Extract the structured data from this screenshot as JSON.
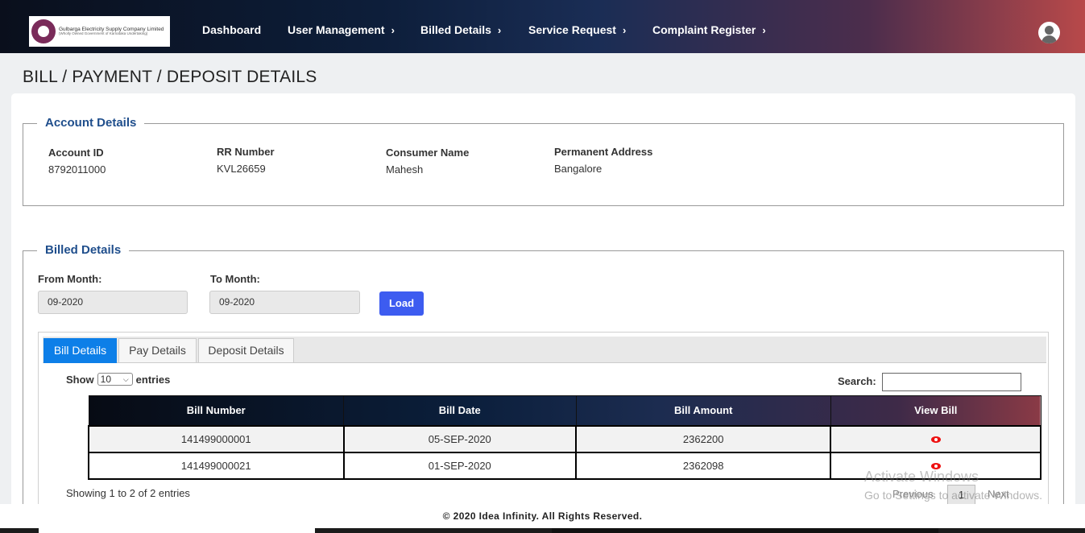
{
  "header": {
    "logo": {
      "line1": "Gulbarga Electricity Supply Company Limited",
      "line2": "(Wholly Owned Government of Karnataka Undertaking)"
    },
    "nav": [
      {
        "label": "Dashboard",
        "has_submenu": false
      },
      {
        "label": "User Management",
        "has_submenu": true
      },
      {
        "label": "Billed Details",
        "has_submenu": true
      },
      {
        "label": "Service Request",
        "has_submenu": true
      },
      {
        "label": "Complaint Register",
        "has_submenu": true
      }
    ],
    "chevron": "›"
  },
  "page": {
    "title": "BILL / PAYMENT / DEPOSIT DETAILS"
  },
  "account": {
    "legend": "Account Details",
    "fields": [
      {
        "label": "Account ID",
        "value": "8792011000"
      },
      {
        "label": "RR Number",
        "value": "KVL26659"
      },
      {
        "label": "Consumer Name",
        "value": "Mahesh"
      },
      {
        "label": "Permanent Address",
        "value": "Bangalore"
      }
    ]
  },
  "billed": {
    "legend": "Billed Details",
    "from_label": "From Month:",
    "from_value": "09-2020",
    "to_label": "To Month:",
    "to_value": "09-2020",
    "load_label": "Load",
    "tabs": [
      {
        "label": "Bill Details",
        "active": true
      },
      {
        "label": "Pay Details",
        "active": false
      },
      {
        "label": "Deposit Details",
        "active": false
      }
    ],
    "show_label": "Show",
    "entries_value": "10",
    "entries_label": "entries",
    "search_label": "Search:",
    "table": {
      "headers": [
        "Bill Number",
        "Bill Date",
        "Bill Amount",
        "View Bill"
      ],
      "rows": [
        {
          "bill_number": "141499000001",
          "bill_date": "05-SEP-2020",
          "bill_amount": "2362200"
        },
        {
          "bill_number": "141499000021",
          "bill_date": "01-SEP-2020",
          "bill_amount": "2362098"
        }
      ]
    },
    "showing_text": "Showing 1 to 2 of 2 entries",
    "pager": {
      "previous": "Previous",
      "page": "1",
      "next": "Next"
    }
  },
  "watermark": {
    "line1": "Activate Windows",
    "line2": "Go to Settings to activate Windows."
  },
  "footer": {
    "text": "© 2020 Idea Infinity. All Rights Reserved."
  },
  "colors": {
    "accent_blue": "#0d7fe8",
    "load_button": "#3d5cf0",
    "legend_text": "#1f4e8c",
    "view_icon": "#e11111"
  }
}
